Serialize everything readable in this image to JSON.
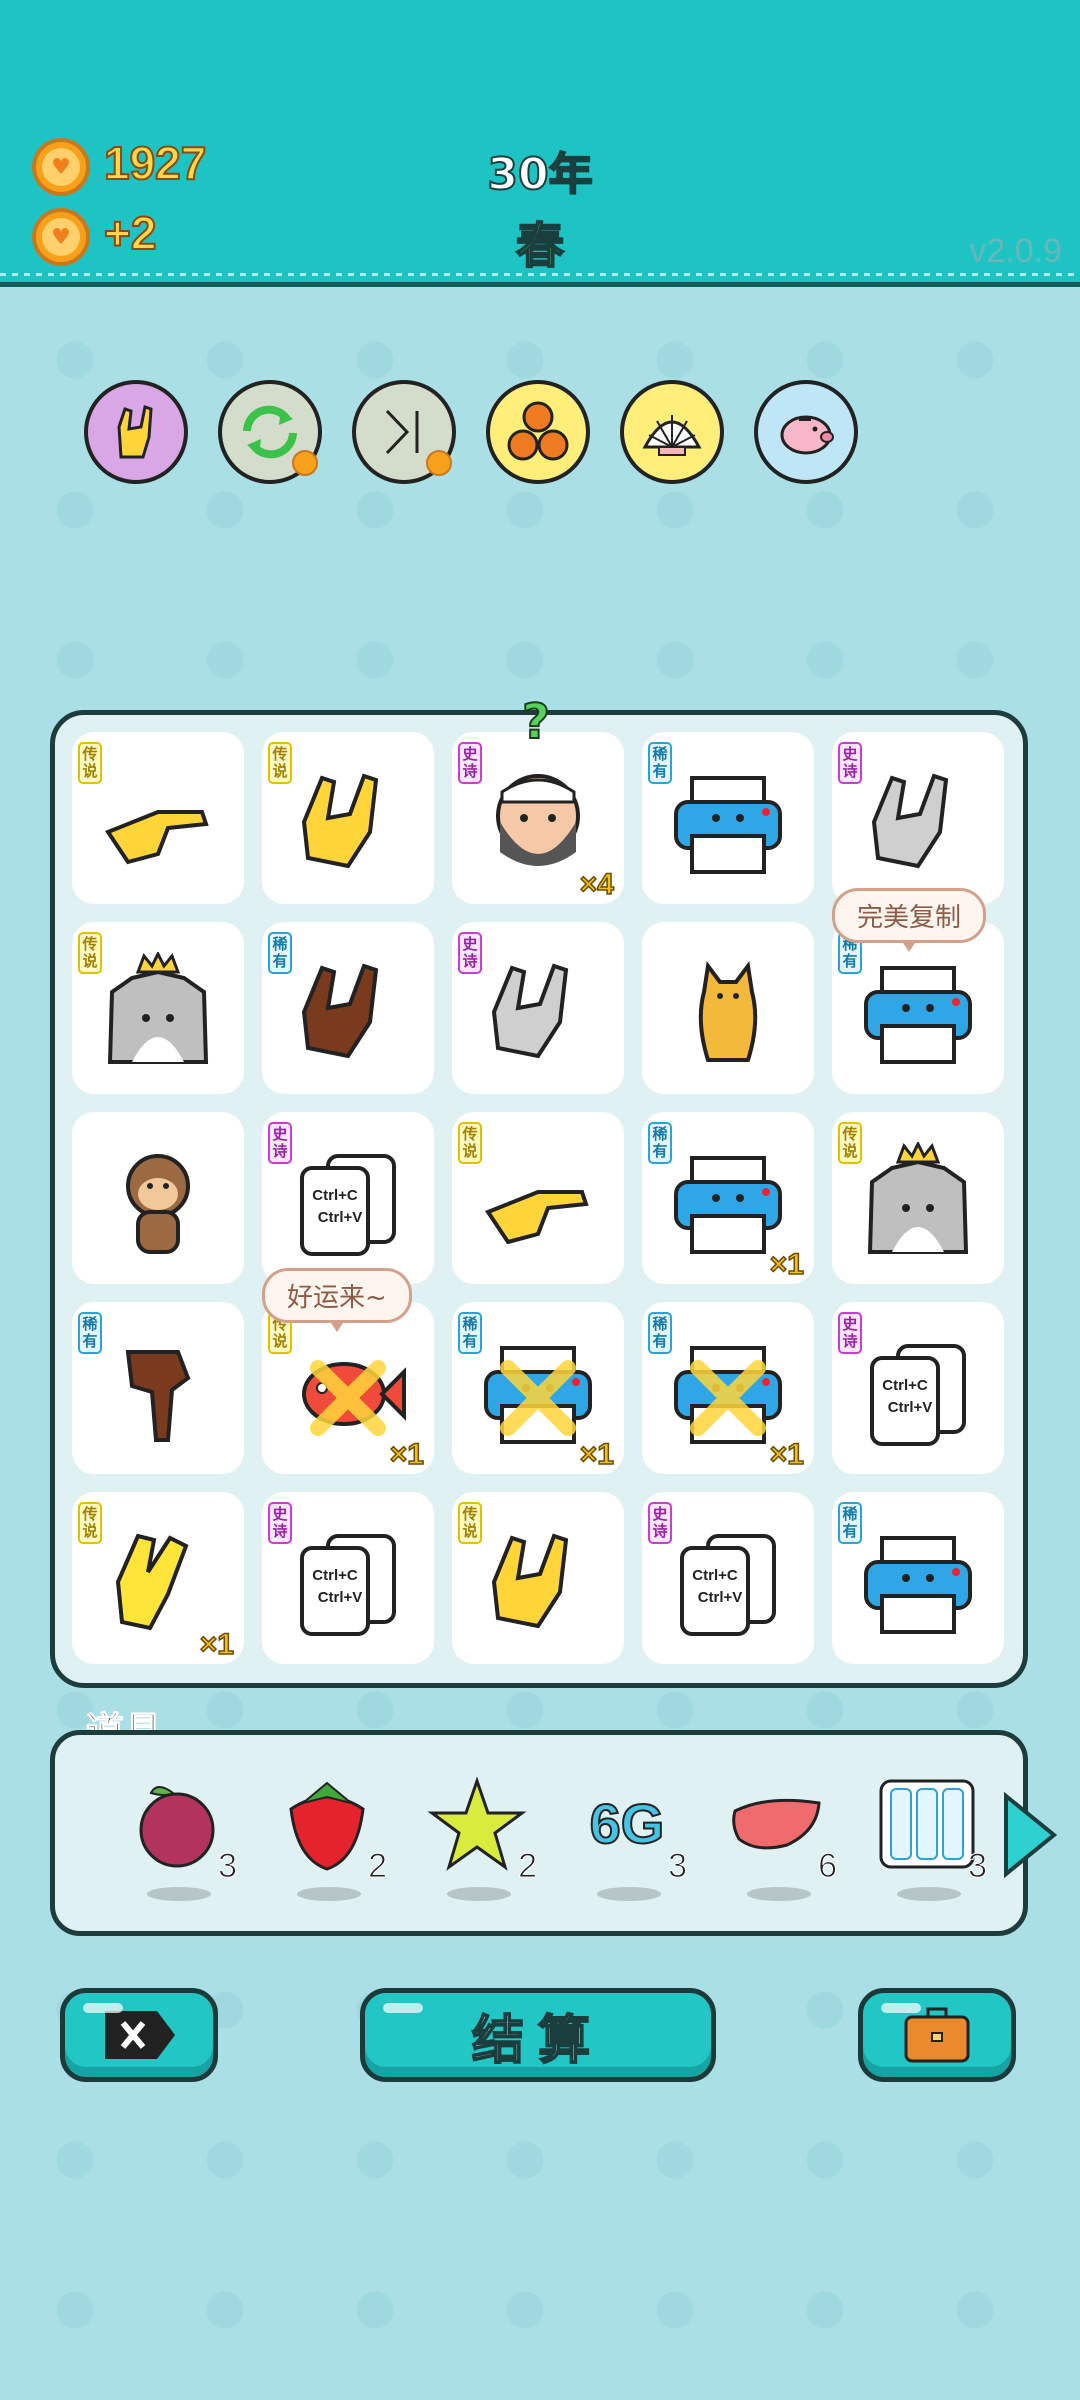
{
  "header": {
    "coins": "1927",
    "income": "+2",
    "year": "30年",
    "season": "春",
    "version": "v2.0.9"
  },
  "skills": [
    {
      "icon": "rock-hand-icon",
      "color": "#d9a6e6"
    },
    {
      "icon": "refresh-icon",
      "color": "#d4dccb"
    },
    {
      "icon": "skip-icon",
      "color": "#d4dccb"
    },
    {
      "icon": "basketballs-icon",
      "color": "#ffef7a"
    },
    {
      "icon": "shell-icon",
      "color": "#ffef7a"
    },
    {
      "icon": "piggy-bank-icon",
      "color": "#bfe6f6"
    }
  ],
  "rarity_labels": {
    "legend": "传说",
    "epic": "史诗",
    "rare": "稀有"
  },
  "board": {
    "cells": [
      {
        "icon": "pointing-hand-icon",
        "rarity": "传说",
        "count": ""
      },
      {
        "icon": "rock-hand-icon",
        "rarity": "传说",
        "count": ""
      },
      {
        "icon": "bearded-man-icon",
        "rarity": "史诗",
        "count": "×4"
      },
      {
        "icon": "printer-icon",
        "rarity": "稀有",
        "count": ""
      },
      {
        "icon": "rock-hand-icon",
        "rarity": "史诗",
        "count": ""
      },
      {
        "icon": "husky-king-icon",
        "rarity": "传说",
        "count": ""
      },
      {
        "icon": "rock-hand-icon",
        "rarity": "稀有",
        "count": ""
      },
      {
        "icon": "rock-hand-icon",
        "rarity": "史诗",
        "count": ""
      },
      {
        "icon": "cat-icon",
        "rarity": "",
        "count": ""
      },
      {
        "icon": "printer-icon",
        "rarity": "稀有",
        "count": ""
      },
      {
        "icon": "monkey-icon",
        "rarity": "",
        "count": ""
      },
      {
        "icon": "copy-paste-icon",
        "rarity": "史诗",
        "count": ""
      },
      {
        "icon": "pointing-hand-icon",
        "rarity": "传说",
        "count": ""
      },
      {
        "icon": "printer-icon",
        "rarity": "稀有",
        "count": "×1"
      },
      {
        "icon": "husky-king-icon",
        "rarity": "传说",
        "count": ""
      },
      {
        "icon": "pointing-down-hand-icon",
        "rarity": "稀有",
        "count": ""
      },
      {
        "icon": "fish-icon",
        "rarity": "传说",
        "count": "×1"
      },
      {
        "icon": "printer-icon",
        "rarity": "稀有",
        "count": "×1"
      },
      {
        "icon": "printer-icon",
        "rarity": "稀有",
        "count": "×1"
      },
      {
        "icon": "copy-paste-icon",
        "rarity": "史诗",
        "count": ""
      },
      {
        "icon": "peace-hand-icon",
        "rarity": "传说",
        "count": "×1"
      },
      {
        "icon": "copy-paste-icon",
        "rarity": "史诗",
        "count": ""
      },
      {
        "icon": "rock-hand-icon",
        "rarity": "传说",
        "count": ""
      },
      {
        "icon": "copy-paste-icon",
        "rarity": "史诗",
        "count": ""
      },
      {
        "icon": "printer-icon",
        "rarity": "稀有",
        "count": ""
      }
    ],
    "bubble_perfect_copy": "完美复制",
    "bubble_good_luck": "好运来~",
    "question_mark": "?",
    "copy_text_1": "Ctrl+C",
    "copy_text_2": "Ctrl+V"
  },
  "items": {
    "title": "道具",
    "list": [
      {
        "icon": "lychee-icon",
        "count": "3"
      },
      {
        "icon": "strawberry-icon",
        "count": "2"
      },
      {
        "icon": "star-icon",
        "count": "2"
      },
      {
        "icon": "6g-icon",
        "label": "6G",
        "count": "3"
      },
      {
        "icon": "liver-icon",
        "count": "6"
      },
      {
        "icon": "rare-cards-icon",
        "count": "3"
      }
    ]
  },
  "buttons": {
    "exit_icon": "exit-icon",
    "settle": "结算",
    "bag_icon": "briefcase-icon"
  }
}
